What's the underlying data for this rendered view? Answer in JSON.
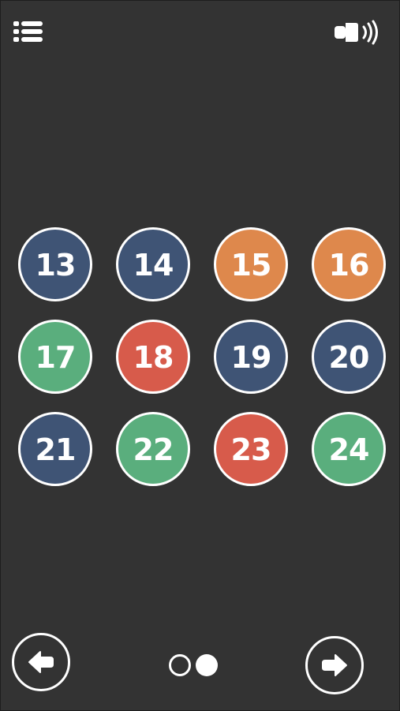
{
  "colors": {
    "background": "#333333",
    "blue": "#3f5475",
    "orange": "#de884c",
    "green": "#5aae7d",
    "red": "#d75b4b",
    "white": "#ffffff"
  },
  "toolbar": {
    "menu_icon": "menu-list-icon",
    "sound_icon": "sound-on-icon"
  },
  "levels": [
    {
      "number": "13",
      "color": "blue"
    },
    {
      "number": "14",
      "color": "blue"
    },
    {
      "number": "15",
      "color": "orange"
    },
    {
      "number": "16",
      "color": "orange"
    },
    {
      "number": "17",
      "color": "green"
    },
    {
      "number": "18",
      "color": "red"
    },
    {
      "number": "19",
      "color": "blue"
    },
    {
      "number": "20",
      "color": "blue"
    },
    {
      "number": "21",
      "color": "blue"
    },
    {
      "number": "22",
      "color": "green"
    },
    {
      "number": "23",
      "color": "red"
    },
    {
      "number": "24",
      "color": "green"
    }
  ],
  "pagination": {
    "total_pages": 2,
    "current_page": 2
  },
  "navigation": {
    "prev_icon": "arrow-left-icon",
    "next_icon": "arrow-right-icon"
  }
}
